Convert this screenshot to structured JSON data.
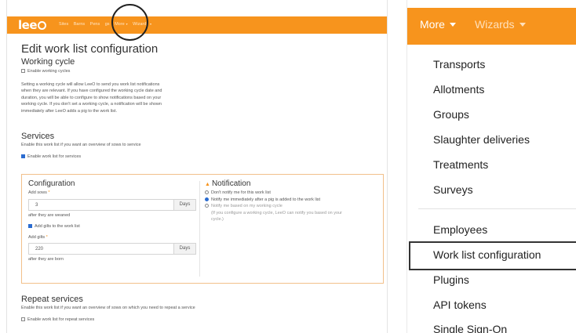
{
  "left": {
    "logo": {
      "text": "lee"
    },
    "nav_items": [
      "Sites",
      "Barns",
      "Pens",
      "gs",
      "More",
      "Wizards"
    ],
    "page_title": "Edit work list configuration",
    "working_cycle": {
      "heading": "Working cycle",
      "checkbox_label": "Enable working cycles",
      "description": [
        "Setting a working cycle will allow LeeO to send you work list notifications",
        "when they are relevant. If you have configured the working cycle date and",
        "duration, you will be able to configure to show notifications based on your",
        "working cycle. If you don't set a working cycle, a notification will be shown",
        "immediately after LeeO adds a pig to the work list."
      ]
    },
    "services": {
      "heading": "Services",
      "description": "Enable this work list if you want an overview of sows to service",
      "checkbox_label": "Enable work list for services",
      "configuration": {
        "heading": "Configuration",
        "add_sows_label": "Add sows",
        "add_sows_value": "3",
        "add_sows_unit": "Days",
        "after_weaned": "after they are weaned",
        "add_gilts_checkbox": "Add gilts to the work list",
        "add_gilts_label": "Add gilts",
        "add_gilts_value": "220",
        "add_gilts_unit": "Days",
        "after_born": "after they are born"
      },
      "notification": {
        "heading": "Notification",
        "options": [
          "Don't notify me for this work list",
          "Notify me immediately after a pig is added to the work list",
          "Notify me based on my working cycle"
        ],
        "hint_line1": "(If you configure a working cycle, LeeO can notify you based on your",
        "hint_line2": "cycle.)"
      }
    },
    "repeat_services": {
      "heading": "Repeat services",
      "description": "Enable this work list if you want an overview of sows on which you need to repeat a service",
      "checkbox_label": "Enable work list for repeat services"
    }
  },
  "right": {
    "top_more": "More",
    "top_wizards": "Wizards",
    "menu_items": [
      "Transports",
      "Allotments",
      "Groups",
      "Slaughter deliveries",
      "Treatments",
      "Surveys",
      "Employees",
      "Work list configuration",
      "Plugins",
      "API tokens",
      "Single Sign-On"
    ]
  },
  "colors": {
    "accent": "#f7941d",
    "checkbox": "#2b6cd0"
  }
}
